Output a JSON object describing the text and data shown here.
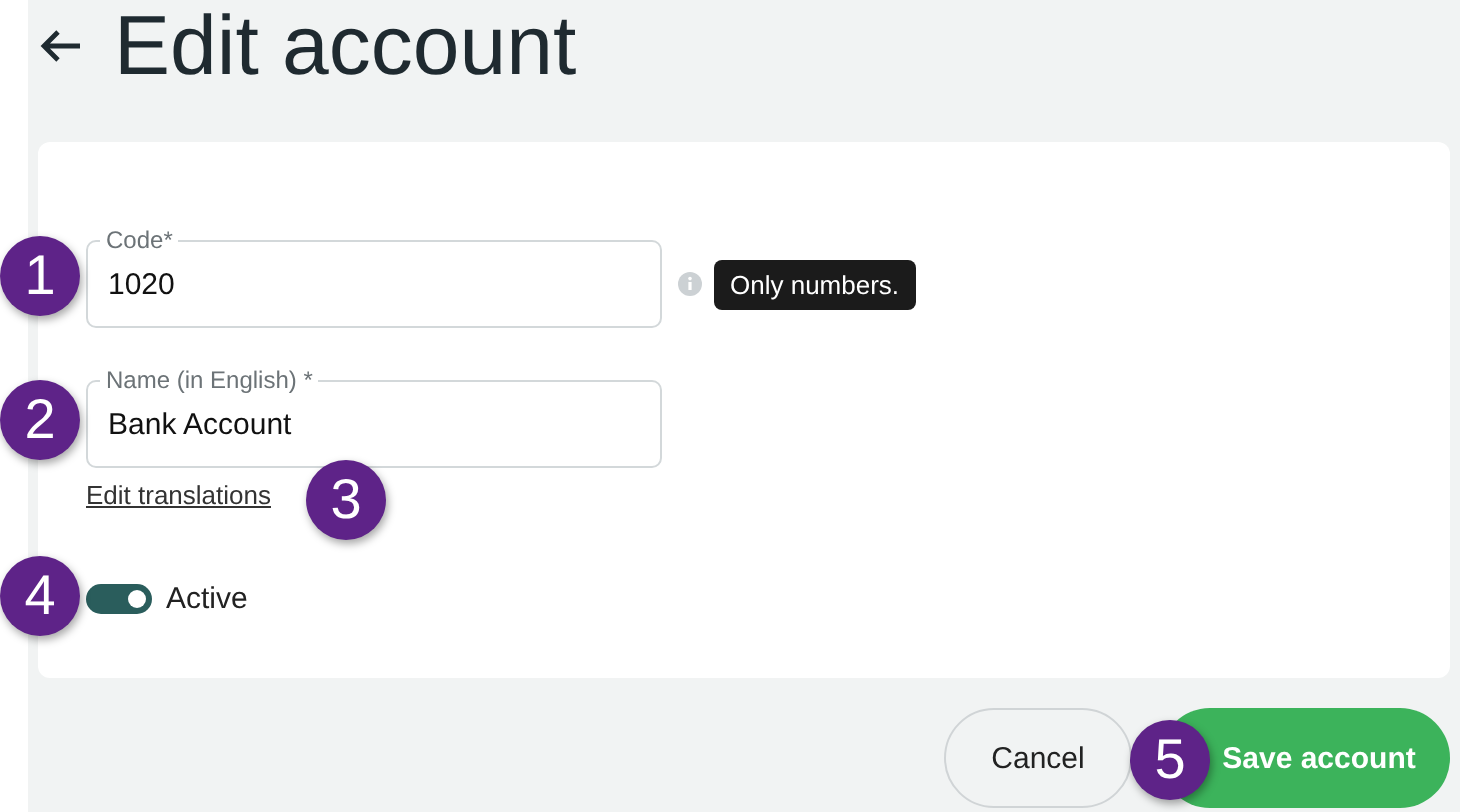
{
  "page": {
    "title": "Edit account"
  },
  "form": {
    "fields": [
      {
        "label": "Code*",
        "value": "1020",
        "hint": "Only numbers."
      },
      {
        "label": "Name (in English) *",
        "value": "Bank Account"
      }
    ],
    "link": "Edit translations",
    "toggle": {
      "label": "Active",
      "on": true
    }
  },
  "buttons": [
    {
      "label": "Cancel",
      "kind": "secondary"
    },
    {
      "label": "Save account",
      "kind": "primary"
    }
  ],
  "callouts": [
    "1",
    "2",
    "3",
    "4",
    "5"
  ]
}
